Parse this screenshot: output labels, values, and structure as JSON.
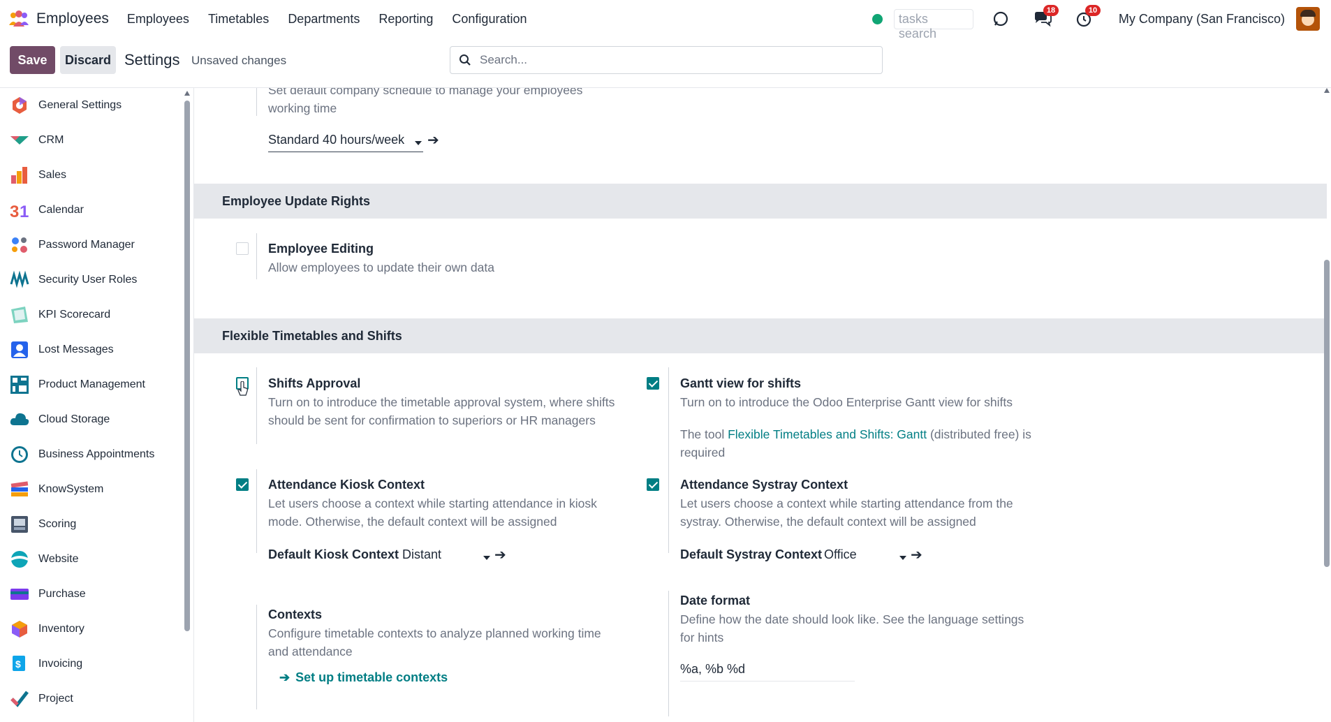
{
  "topbar": {
    "app_name": "Employees",
    "menu": [
      "Employees",
      "Timetables",
      "Departments",
      "Reporting",
      "Configuration"
    ],
    "tasks_search_placeholder": "tasks search",
    "messages_badge": "18",
    "activities_badge": "10",
    "company": "My Company (San Francisco)"
  },
  "control": {
    "save_label": "Save",
    "discard_label": "Discard",
    "title": "Settings",
    "status": "Unsaved changes",
    "search_placeholder": "Search..."
  },
  "sidebar": {
    "items": [
      {
        "label": "General Settings",
        "icon": "general-settings-icon"
      },
      {
        "label": "CRM",
        "icon": "crm-icon"
      },
      {
        "label": "Sales",
        "icon": "sales-icon"
      },
      {
        "label": "Calendar",
        "icon": "calendar-icon"
      },
      {
        "label": "Password Manager",
        "icon": "password-manager-icon"
      },
      {
        "label": "Security User Roles",
        "icon": "security-roles-icon"
      },
      {
        "label": "KPI Scorecard",
        "icon": "kpi-scorecard-icon"
      },
      {
        "label": "Lost Messages",
        "icon": "lost-messages-icon"
      },
      {
        "label": "Product Management",
        "icon": "product-management-icon"
      },
      {
        "label": "Cloud Storage",
        "icon": "cloud-storage-icon"
      },
      {
        "label": "Business Appointments",
        "icon": "appointments-icon"
      },
      {
        "label": "KnowSystem",
        "icon": "knowsystem-icon"
      },
      {
        "label": "Scoring",
        "icon": "scoring-icon"
      },
      {
        "label": "Website",
        "icon": "website-icon"
      },
      {
        "label": "Purchase",
        "icon": "purchase-icon"
      },
      {
        "label": "Inventory",
        "icon": "inventory-icon"
      },
      {
        "label": "Invoicing",
        "icon": "invoicing-icon"
      },
      {
        "label": "Project",
        "icon": "project-icon"
      }
    ]
  },
  "schedule": {
    "desc_line1": "Set default company schedule to manage your employees",
    "desc_line2": "working time",
    "value": "Standard 40 hours/week"
  },
  "update_rights": {
    "header": "Employee Update Rights",
    "editing_title": "Employee Editing",
    "editing_desc": "Allow employees to update their own data",
    "editing_checked": false
  },
  "flex": {
    "header": "Flexible Timetables and Shifts",
    "shifts_approval": {
      "title": "Shifts Approval",
      "desc_line1": "Turn on to introduce the timetable approval system, where shifts",
      "desc_line2": "should be sent for confirmation to superiors or HR managers",
      "checked": false
    },
    "gantt": {
      "title": "Gantt view for shifts",
      "desc": "Turn on to introduce the Odoo Enterprise Gantt view for shifts",
      "note_prefix": "The tool ",
      "note_link": "Flexible Timetables and Shifts: Gantt",
      "note_suffix": " (distributed free) is",
      "note_line2": "required",
      "checked": true
    },
    "kiosk": {
      "title": "Attendance Kiosk Context",
      "desc_line1": "Let users choose a context while starting attendance in kiosk",
      "desc_line2": "mode. Otherwise, the default context will be assigned",
      "field_label": "Default Kiosk Context",
      "field_value": "Distant",
      "checked": true
    },
    "systray": {
      "title": "Attendance Systray Context",
      "desc_line1": "Let users choose a context while starting attendance from the",
      "desc_line2": "systray. Otherwise, the default context will be assigned",
      "field_label": "Default Systray Context",
      "field_value": "Office",
      "checked": true
    },
    "contexts": {
      "title": "Contexts",
      "desc_line1": "Configure timetable contexts to analyze planned working time",
      "desc_line2": "and attendance",
      "link": "Set up timetable contexts"
    },
    "date_format": {
      "title": "Date format",
      "desc_line1": "Define how the date should look like. See the language settings",
      "desc_line2": "for hints",
      "value": "%a, %b %d"
    }
  },
  "colors": {
    "brand": "#714b67",
    "accent": "#017e84",
    "badge": "#dc2626",
    "online": "#10a574"
  }
}
